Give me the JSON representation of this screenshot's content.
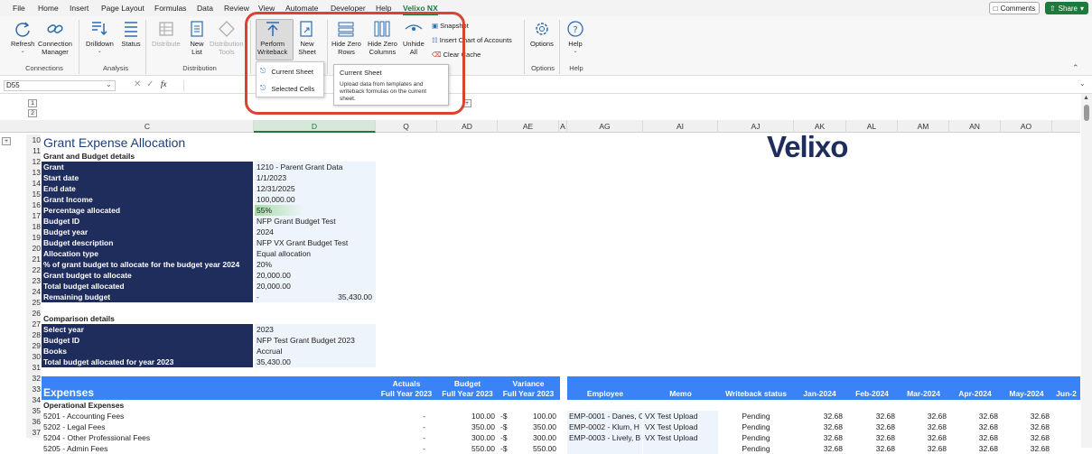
{
  "menu": {
    "items": [
      "File",
      "Home",
      "Insert",
      "Page Layout",
      "Formulas",
      "Data",
      "Review",
      "View",
      "Automate",
      "Developer",
      "Help",
      "Velixo NX"
    ],
    "active": "Velixo NX",
    "comments_label": "Comments",
    "share_label": "Share"
  },
  "ribbon": {
    "refresh": "Refresh",
    "connection_manager": [
      "Connection",
      "Manager"
    ],
    "drilldown": "Drilldown",
    "status": "Status",
    "distribute": "Distribute",
    "new_list": [
      "New",
      "List"
    ],
    "distribution_tools": [
      "Distribution",
      "Tools"
    ],
    "perform_writeback": [
      "Perform",
      "Writeback"
    ],
    "new_sheet": [
      "New",
      "Sheet"
    ],
    "hide_zero_rows": [
      "Hide Zero",
      "Rows"
    ],
    "hide_zero_columns": [
      "Hide Zero",
      "Columns"
    ],
    "unhide_all": [
      "Unhide",
      "All"
    ],
    "snapshot": "Snapshot",
    "insert_chart_of_accounts": "Insert Chart of Accounts",
    "clear_cache": "Clear Cache",
    "options": "Options",
    "help": "Help",
    "groups": {
      "connections": "Connections",
      "analysis": "Analysis",
      "distribution": "Distribution",
      "options": "Options",
      "help": "Help"
    }
  },
  "dropdown": {
    "items": [
      "Current Sheet",
      "Selected Cells"
    ]
  },
  "tooltip": {
    "title": "Current Sheet",
    "body": "Upload data from templates and writeback formulas on the current sheet."
  },
  "formula_bar": {
    "name_box": "D55",
    "fx": "fx"
  },
  "outline": {
    "levels": [
      "1",
      "2"
    ],
    "row_levels": [
      "1",
      "2"
    ],
    "plus": "+"
  },
  "columns": [
    "C",
    "D",
    "Q",
    "AD",
    "AE",
    "A",
    "AG",
    "AI",
    "AJ",
    "AK",
    "AL",
    "AM",
    "AN",
    "AO"
  ],
  "selected_column": "D",
  "rows": [
    "10",
    "11",
    "12",
    "13",
    "14",
    "15",
    "16",
    "17",
    "18",
    "19",
    "20",
    "21",
    "22",
    "23",
    "24",
    "25",
    "26",
    "27",
    "28",
    "29",
    "30",
    "31",
    "32",
    "33",
    "34",
    "35",
    "36",
    "37"
  ],
  "logo": "Velixo",
  "sheet": {
    "title": "Grant Expense Allocation",
    "section1": "Grant and Budget details",
    "details": [
      {
        "label": "Grant",
        "value": "1210 - Parent Grant Data"
      },
      {
        "label": "Start date",
        "value": "1/1/2023"
      },
      {
        "label": "End date",
        "value": "12/31/2025"
      },
      {
        "label": "Grant Income",
        "value": "100,000.00"
      },
      {
        "label": "Percentage allocated",
        "value": "55%"
      },
      {
        "label": "Budget ID",
        "value": "NFP Grant Budget Test"
      },
      {
        "label": "Budget year",
        "value": "2024"
      },
      {
        "label": "Budget description",
        "value": "NFP VX Grant Budget Test"
      },
      {
        "label": "Allocation type",
        "value": "Equal allocation"
      },
      {
        "label": "% of grant budget to allocate for the budget year 2024",
        "value": "20%"
      },
      {
        "label": "Grant budget to allocate",
        "value": "20,000.00"
      },
      {
        "label": "Total budget allocated",
        "value": "20,000.00"
      },
      {
        "label": "Remaining budget",
        "value": "-",
        "value2": "35,430.00"
      }
    ],
    "section2": "Comparison details",
    "comparison": [
      {
        "label": "Select year",
        "value": "2023"
      },
      {
        "label": "Budget ID",
        "value": "NFP Test Grant Budget 2023"
      },
      {
        "label": "Books",
        "value": "Accrual"
      },
      {
        "label": "Total budget allocated for year 2023",
        "value": "35,430.00"
      }
    ],
    "expenses_header": "Expenses",
    "headers": {
      "actuals": [
        "Actuals",
        "Full Year 2023"
      ],
      "budget": [
        "Budget",
        "Full Year 2023"
      ],
      "variance": [
        "Variance",
        "Full Year 2023"
      ],
      "employee": "Employee",
      "memo": "Memo",
      "writeback_status": "Writeback status",
      "months": [
        "Jan-2024",
        "Feb-2024",
        "Mar-2024",
        "Apr-2024",
        "May-2024",
        "Jun-2"
      ]
    },
    "operational": "Operational Expenses",
    "expense_rows": [
      {
        "account": "5201 - Accounting Fees",
        "actuals": "-",
        "budget": "100.00",
        "var_cur": "-$",
        "variance": "100.00",
        "employee": "EMP-0001 - Danes, C",
        "memo": "VX Test Upload",
        "status": "Pending",
        "months": [
          "32.68",
          "32.68",
          "32.68",
          "32.68",
          "32.68"
        ]
      },
      {
        "account": "5202 - Legal Fees",
        "actuals": "-",
        "budget": "350.00",
        "var_cur": "-$",
        "variance": "350.00",
        "employee": "EMP-0002 - Klum, H",
        "memo": "VX Test Upload",
        "status": "Pending",
        "months": [
          "32.68",
          "32.68",
          "32.68",
          "32.68",
          "32.68"
        ]
      },
      {
        "account": "5204 - Other Professional Fees",
        "actuals": "-",
        "budget": "300.00",
        "var_cur": "-$",
        "variance": "300.00",
        "employee": "EMP-0003 - Lively, B",
        "memo": "VX Test Upload",
        "status": "Pending",
        "months": [
          "32.68",
          "32.68",
          "32.68",
          "32.68",
          "32.68"
        ]
      },
      {
        "account": "5205 - Admin Fees",
        "actuals": "-",
        "budget": "550.00",
        "var_cur": "-$",
        "variance": "550.00",
        "employee": "",
        "memo": "",
        "status": "Pending",
        "months": [
          "32.68",
          "32.68",
          "32.68",
          "32.68",
          "32.68"
        ]
      }
    ]
  }
}
